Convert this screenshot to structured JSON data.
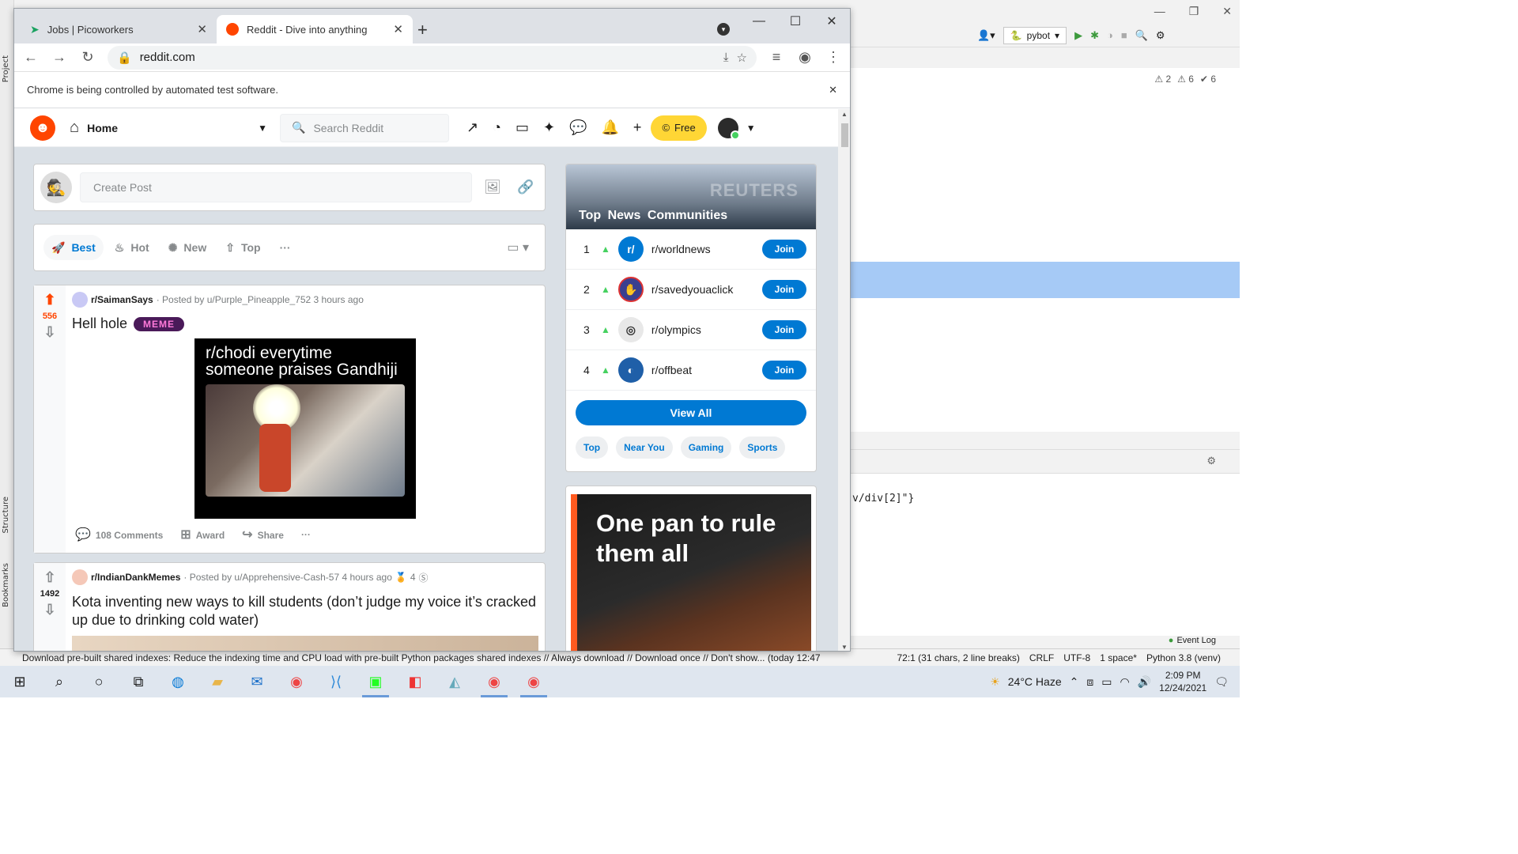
{
  "chrome": {
    "tabs": [
      {
        "title": "Jobs | Picoworkers",
        "icon": "picoworkers-icon"
      },
      {
        "title": "Reddit - Dive into anything",
        "icon": "reddit-icon"
      }
    ],
    "url": "reddit.com",
    "infobar": "Chrome is being controlled by automated test software."
  },
  "reddit": {
    "home_label": "Home",
    "search_placeholder": "Search Reddit",
    "free_label": "Free",
    "create_post_placeholder": "Create Post",
    "sort": [
      "Best",
      "Hot",
      "New",
      "Top"
    ],
    "posts": [
      {
        "subreddit": "r/SaimanSays",
        "posted_by": "· Posted by u/Purple_Pineapple_752 3 hours ago",
        "score": "556",
        "title": "Hell hole",
        "flair": "MEME",
        "meme_caption": "r/chodi everytime someone praises Gandhiji",
        "comments": "108 Comments",
        "award": "Award",
        "share": "Share"
      },
      {
        "subreddit": "r/IndianDankMemes",
        "posted_by": "· Posted by u/Apprehensive-Cash-57 4 hours ago",
        "award_count": "4",
        "score": "1492",
        "title": "Kota inventing new ways to kill students (don’t judge my voice it’s cracked up due to drinking cold water)"
      }
    ],
    "sidebar": {
      "banner_title": "Top News Communities",
      "banner_watermark": "REUTERS",
      "communities": [
        {
          "rank": "1",
          "name": "r/worldnews",
          "color": "#0079d3"
        },
        {
          "rank": "2",
          "name": "r/savedyouaclick",
          "color": "#3b3f8f"
        },
        {
          "rank": "3",
          "name": "r/olympics",
          "color": "#e8e8e8"
        },
        {
          "rank": "4",
          "name": "r/offbeat",
          "color": "#1f5fa8"
        }
      ],
      "join_label": "Join",
      "view_all": "View All",
      "chips": [
        "Top",
        "Near You",
        "Gaming",
        "Sports"
      ]
    },
    "ad_text": "One pan to rule them all"
  },
  "ide": {
    "run_config": "pybot",
    "inspections": [
      "2",
      "6",
      "6"
    ],
    "console_line": "v/div[2]\"}",
    "event_log": "Event Log",
    "status_message": "Download pre-built shared indexes: Reduce the indexing time and CPU load with pre-built Python packages shared indexes // Always download // Download once // Don't show... (today 12:47",
    "position": "72:1 (31 chars, 2 line breaks)",
    "line_sep": "CRLF",
    "encoding": "UTF-8",
    "indent": "1 space*",
    "interpreter": "Python 3.8 (venv)",
    "side_labels": [
      "Project",
      "Structure",
      "Bookmarks"
    ]
  },
  "taskbar": {
    "weather": "24°C Haze",
    "time": "2:09 PM",
    "date": "12/24/2021"
  }
}
